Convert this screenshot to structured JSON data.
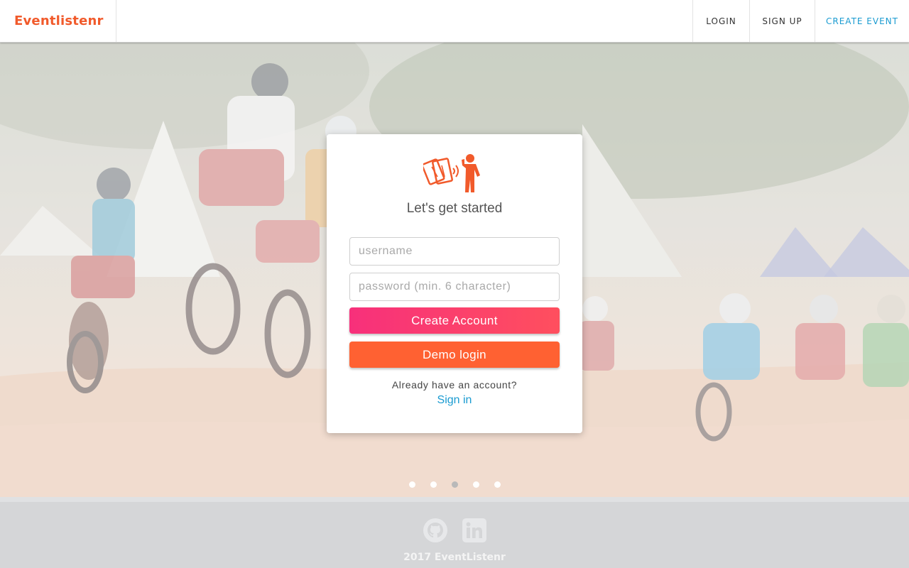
{
  "navbar": {
    "brand": "Eventlistenr",
    "links": {
      "login": "LOGIN",
      "signup": "SIGN UP",
      "create_event": "CREATE EVENT"
    }
  },
  "signup_card": {
    "logo_icon": "tickets-person-icon",
    "title": "Let's get started",
    "username_placeholder": "username",
    "password_placeholder": "password (min. 6 character)",
    "create_account_label": "Create Account",
    "demo_login_label": "Demo login",
    "already_text": "Already have an account?",
    "signin_label": "Sign in"
  },
  "carousel": {
    "dots": 5,
    "active_index": 2
  },
  "footer": {
    "icons": [
      "github-icon",
      "linkedin-icon"
    ],
    "copyright": "2017 EventListenr"
  },
  "colors": {
    "brand": "#f15a2b",
    "accent_link": "#1a9bd1",
    "create_button": "#f7307b",
    "demo_button": "#ff6132"
  }
}
